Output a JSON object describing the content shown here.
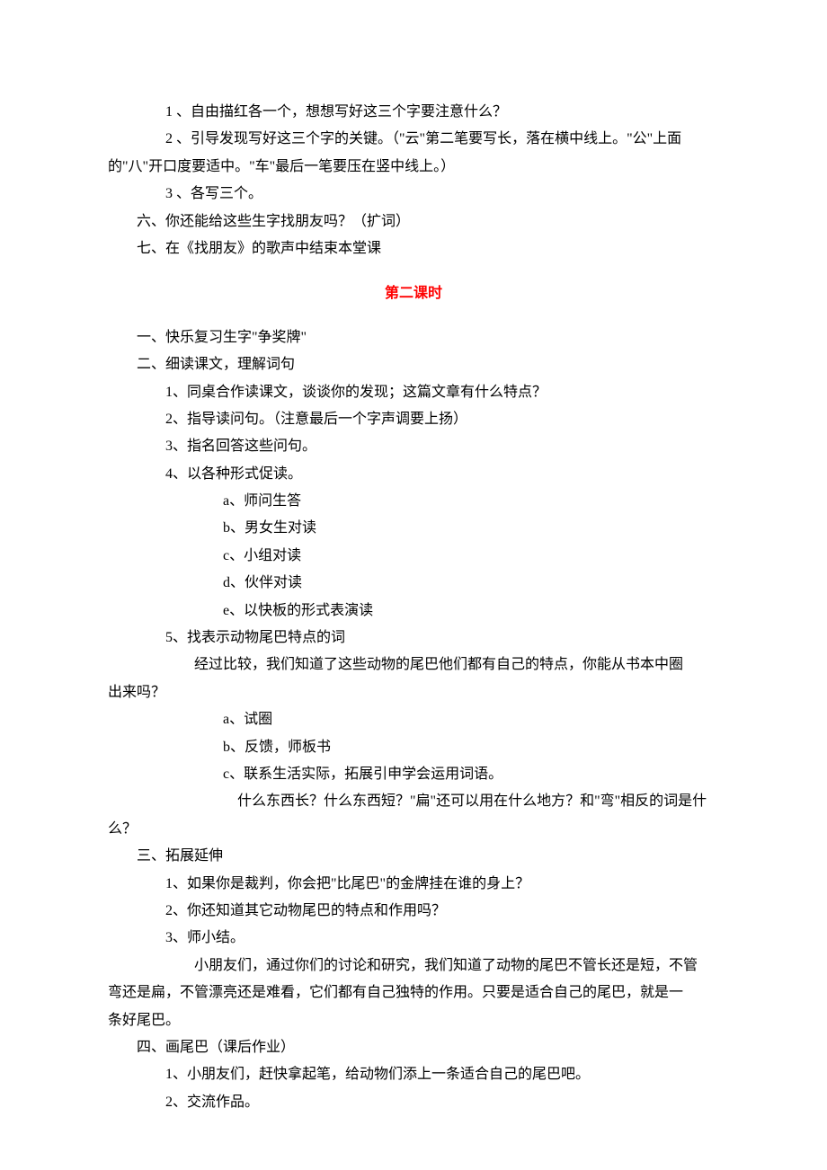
{
  "section_a": {
    "line1": "1 、自由描红各一个，想想写好这三个字要注意什么？",
    "line2a": "2 、引导发现写好这三个字的关键。（\"云\"第二笔要写长，落在横中线上。\"公\"上面",
    "line2b": "的\"八\"开口度要适中。\"车\"最后一笔要压在竖中线上。）",
    "line3": "3 、各写三个。",
    "line4": "六、你还能给这些生字找朋友吗？（扩词）",
    "line5": "七、在《找朋友》的歌声中结束本堂课"
  },
  "title": "第二课时",
  "section_b": {
    "h1": "一、快乐复习生字\"争奖牌\"",
    "h2": "二、细读课文，理解词句",
    "b1": "1、同桌合作读课文，谈谈你的发现；这篇文章有什么特点？",
    "b2": "2、指导读问句。（注意最后一个字声调要上扬）",
    "b3": "3、指名回答这些问句。",
    "b4": "4、以各种形式促读。",
    "b4a": "a、师问生答",
    "b4b": "b、男女生对读",
    "b4c": "c、小组对读",
    "b4d": "d、伙伴对读",
    "b4e": "e、以快板的形式表演读",
    "b5": "5、找表示动物尾巴特点的词",
    "b5text_a": "经过比较，我们知道了这些动物的尾巴他们都有自己的特点，你能从书本中圈",
    "b5text_b": "出来吗？",
    "b5a": "a、试圈",
    "b5b": "b、反馈，师板书",
    "b5c": "c、联系生活实际，拓展引申学会运用词语。",
    "b5q_a": "什么东西长？什么东西短？\"扁\"还可以用在什么地方？和\"弯\"相反的词是什",
    "b5q_b": "么？",
    "h3": "三、拓展延伸",
    "c1": "1、如果你是裁判，你会把\"比尾巴\"的金牌挂在谁的身上？",
    "c2": "2、你还知道其它动物尾巴的特点和作用吗？",
    "c3": "3、师小结。",
    "c3text_a": "小朋友们，通过你们的讨论和研究，我们知道了动物的尾巴不管长还是短，不管",
    "c3text_b": "弯还是扁，不管漂亮还是难看，它们都有自己独特的作用。只要是适合自己的尾巴，就是一",
    "c3text_c": "条好尾巴。",
    "h4": "四、画尾巴（课后作业）",
    "d1": "1、小朋友们，赶快拿起笔，给动物们添上一条适合自己的尾巴吧。",
    "d2": "2、交流作品。"
  }
}
